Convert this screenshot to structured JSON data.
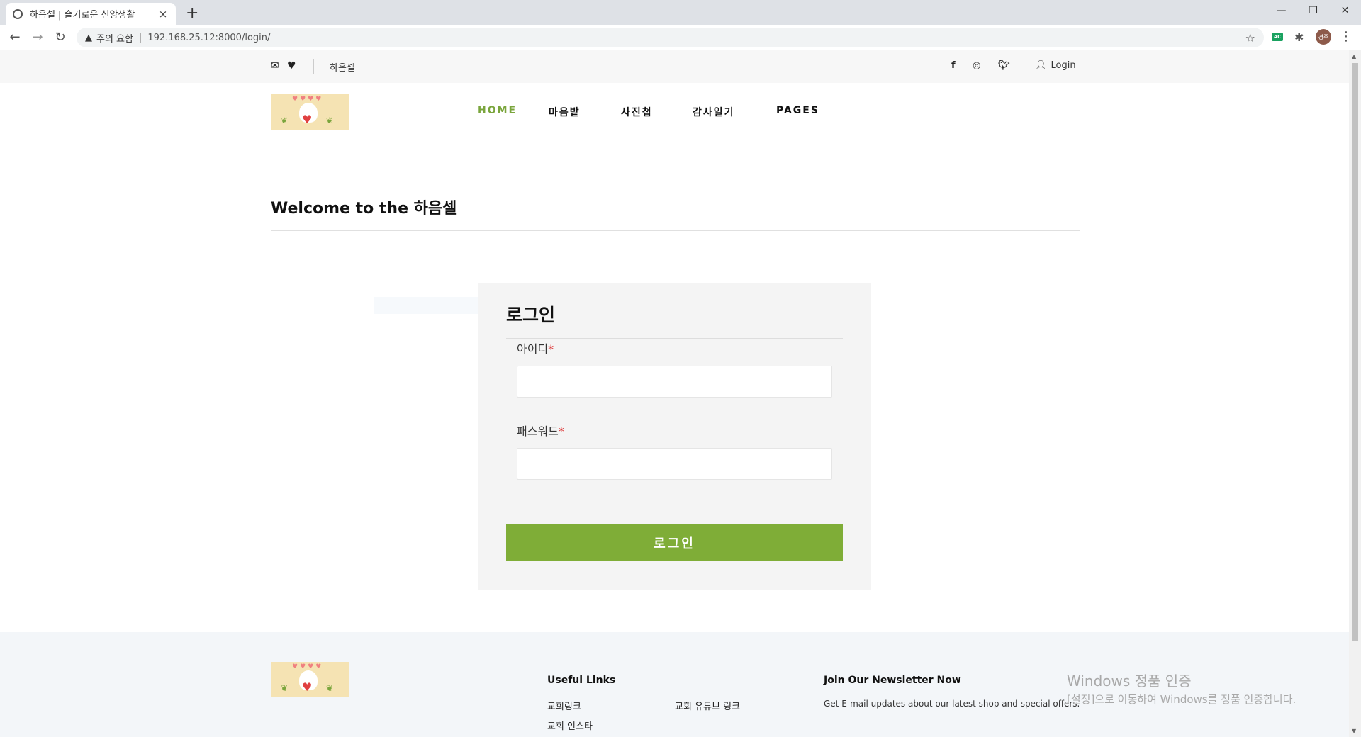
{
  "browser": {
    "tab_title": "하음셀 | 슬기로운 신앙생활",
    "tab_close": "×",
    "new_tab": "+",
    "window_controls": [
      "—",
      "❐",
      "✕"
    ],
    "back": "←",
    "forward": "→",
    "reload": "↻",
    "security_warning": "주의 요함",
    "separator": "|",
    "url": "192.168.25.12:8000/login/",
    "extension_badge": "AC",
    "profile_initials": "경주"
  },
  "topbar": {
    "site_name": "하음셀",
    "login_label": "Login"
  },
  "nav": {
    "items": [
      "HOME",
      "마음밭",
      "사진첩",
      "감사일기",
      "PAGES"
    ],
    "active": "HOME"
  },
  "page": {
    "welcome_prefix": "Welcome to the ",
    "welcome_site": "하음셀"
  },
  "login_form": {
    "title": "로그인",
    "id_label": "아이디",
    "password_label": "패스워드",
    "required_mark": "*",
    "submit_label": "로그인"
  },
  "footer": {
    "useful_links_heading": "Useful Links",
    "links": [
      "교회링크",
      "교회 유튜브 링크",
      "교회 인스타"
    ],
    "newsletter_heading": "Join Our Newsletter Now",
    "newsletter_text": "Get E-mail updates about our latest shop and special offers."
  },
  "watermark": {
    "title": "Windows 정품 인증",
    "subtitle": "[설정]으로 이동하여 Windows를 정품 인증합니다."
  },
  "colors": {
    "accent": "#7fad37",
    "login_box_bg": "#f4f4f4",
    "footer_bg": "#f3f6f9"
  }
}
